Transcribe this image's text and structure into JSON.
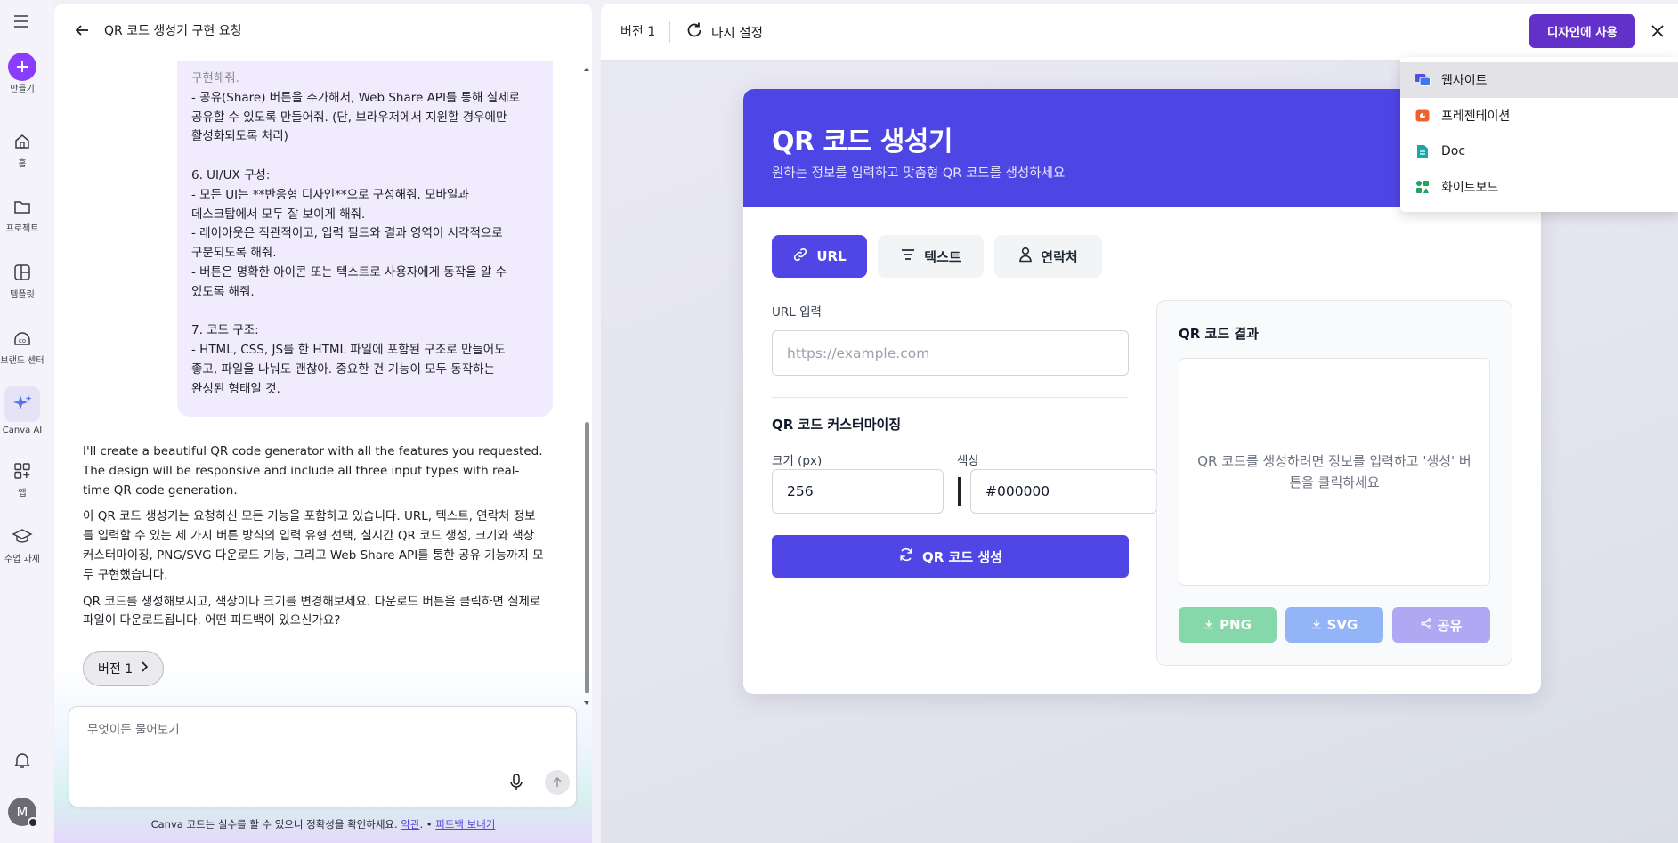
{
  "rail": {
    "create": "만들기",
    "home": "홈",
    "projects": "프로젝트",
    "templates": "템플릿",
    "brand": "브랜드 센터",
    "canva_ai": "Canva AI",
    "apps": "앱",
    "assignments": "수업 과제",
    "avatar_initial": "M"
  },
  "chat": {
    "title": "QR 코드 생성기 구현 요청",
    "user_message_lines": [
      "구현해줘.",
      "- 공유(Share) 버튼을 추가해서, Web Share API를 통해 실제로",
      "공유할 수 있도록 만들어줘. (단, 브라우저에서 지원할 경우에만",
      "활성화되도록 처리)",
      "",
      "6. UI/UX 구성:",
      "- 모든 UI는 **반응형 디자인**으로 구성해줘. 모바일과",
      "데스크탑에서 모두 잘 보이게 해줘.",
      "- 레이아웃은 직관적이고, 입력 필드와 결과 영역이 시각적으로",
      "구분되도록 해줘.",
      "- 버튼은 명확한 아이콘 또는 텍스트로 사용자에게 동작을 알 수",
      "있도록 해줘.",
      "",
      "7. 코드 구조:",
      "- HTML, CSS, JS를 한 HTML 파일에 포함된 구조로 만들어도",
      "좋고, 파일을 나눠도 괜찮아. 중요한 건 기능이 모두 동작하는",
      "완성된 형태일 것."
    ],
    "ai_paragraphs": [
      "I'll create a beautiful QR code generator with all the features you requested. The design will be responsive and include all three input types with real-time QR code generation.",
      "이 QR 코드 생성기는 요청하신 모든 기능을 포함하고 있습니다. URL, 텍스트, 연락처 정보를 입력할 수 있는 세 가지 버튼 방식의 입력 유형 선택, 실시간 QR 코드 생성, 크기와 색상 커스터마이징, PNG/SVG 다운로드 기능, 그리고 Web Share API를 통한 공유 기능까지 모두 구현했습니다.",
      "QR 코드를 생성해보시고, 색상이나 크기를 변경해보세요. 다운로드 버튼을 클릭하면 실제로 파일이 다운로드됩니다. 어떤 피드백이 있으신가요?"
    ],
    "version_chip": "버전 1",
    "input_placeholder": "무엇이든 물어보기",
    "disclaimer_text": "Canva 코드는 실수를 할 수 있으니 정확성을 확인하세요.",
    "terms_link": "약관",
    "feedback_link": "피드백 보내기"
  },
  "preview": {
    "version_label": "버전 1",
    "reset_label": "다시 설정",
    "use_in_design": "디자인에 사용",
    "menu_items": [
      {
        "label": "웹사이트",
        "icon": "website-icon",
        "color": "#5b4be0"
      },
      {
        "label": "프레젠테이션",
        "icon": "presentation-icon",
        "color": "#f2602e"
      },
      {
        "label": "Doc",
        "icon": "doc-icon",
        "color": "#1aa7a8"
      },
      {
        "label": "화이트보드",
        "icon": "whiteboard-icon",
        "color": "#22a45d"
      }
    ]
  },
  "app": {
    "title": "QR 코드 생성기",
    "subtitle": "원하는 정보를 입력하고 맞춤형 QR 코드를 생성하세요",
    "tabs": [
      "URL",
      "텍스트",
      "연락처"
    ],
    "active_tab": "URL",
    "url_label": "URL 입력",
    "url_placeholder": "https://example.com",
    "custom_title": "QR 코드 커스터마이징",
    "size_label": "크기 (px)",
    "size_value": "256",
    "color_label": "색상",
    "color_value": "#000000",
    "generate_button": "QR 코드 생성",
    "result_title": "QR 코드 결과",
    "result_placeholder": "QR 코드를 생성하려면 정보를 입력하고 '생성' 버튼을 클릭하세요",
    "png_button": "PNG",
    "svg_button": "SVG",
    "share_button": "공유",
    "accent_color": "#4f46e5"
  }
}
